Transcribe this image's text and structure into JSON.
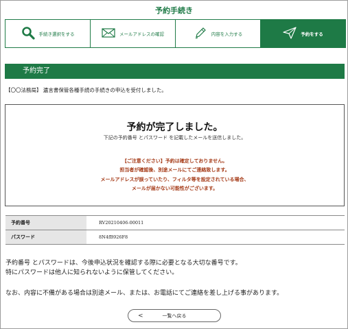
{
  "page_title": "予約手続き",
  "steps": [
    {
      "label": "手続き選択をする",
      "icon": "search-icon"
    },
    {
      "label": "メールアドレスの確認",
      "icon": "mail-icon"
    },
    {
      "label": "内容を入力する",
      "icon": "pencil-icon"
    },
    {
      "label": "予約をする",
      "icon": "send-icon",
      "active": true
    }
  ],
  "section_title": "予約完了",
  "notice": "【〇〇法務局】 遺言書保管各種手続の手続きの申込を受付しました。",
  "completion": {
    "title": "予約が完了しました。",
    "subtitle": "下記の予約番号 とパスワード を記載したメールを送信しました。",
    "caution_lines": [
      "【ご注意ください】予約は確定しておりません。",
      "担当者が確認後、別途メールにてご連絡致します。",
      "メールアドレスが誤っていたり、フィルタ等を設定されている場合、",
      "メールが届かない可能性がございます。"
    ]
  },
  "info": {
    "reservation_label": "予約番号",
    "reservation_value": "RV20210406-00011",
    "password_label": "パスワード",
    "password_value": "8N4fB926F8"
  },
  "notes": [
    "予約番号 とパスワードは、今後申込状況を確認する際に必要となる大切な番号です。",
    "特にパスワードは他人に知られないように保管してください。",
    "なお、内容に不備がある場合は別途メール、または、お電話にてご連絡を差し上げる事があります。"
  ],
  "back_button": {
    "chevron": "<",
    "label": "一覧へ戻る"
  },
  "colors": {
    "brand_green": "#1e7a46",
    "caution": "#a53a17"
  }
}
